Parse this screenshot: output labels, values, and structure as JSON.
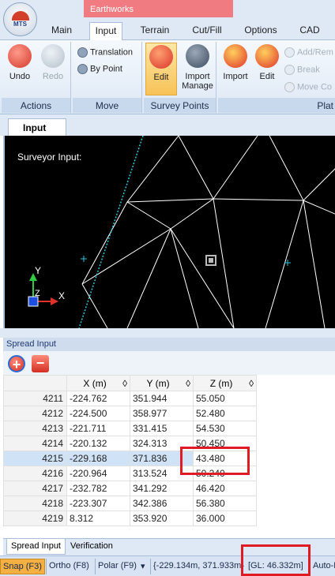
{
  "app": {
    "title": "Earthworks",
    "logo_text": "MTS"
  },
  "tabs": [
    {
      "label": "Main"
    },
    {
      "label": "Input"
    },
    {
      "label": "Terrain"
    },
    {
      "label": "Cut/Fill"
    },
    {
      "label": "Options"
    },
    {
      "label": "CAD"
    }
  ],
  "active_tab": "Input",
  "ribbon": {
    "actions": {
      "label": "Actions",
      "undo": "Undo",
      "redo": "Redo"
    },
    "move": {
      "label": "Move",
      "translation": "Translation",
      "by_point": "By Point"
    },
    "survey_points": {
      "label": "Survey Points",
      "edit": "Edit",
      "import_manage_line1": "Import",
      "import_manage_line2": "Manage"
    },
    "platform": {
      "label": "Plat",
      "import": "Import",
      "edit": "Edit",
      "add_remove": "Add/Rem",
      "break": "Break",
      "move_co": "Move Co"
    }
  },
  "document_tab": "Input",
  "canvas": {
    "label": "Surveyor Input:",
    "axis_y": "Y",
    "axis_x": "X",
    "axis_z": "Z"
  },
  "spread": {
    "title": "Spread Input",
    "add_icon": "plus-icon",
    "remove_icon": "minus-icon",
    "columns": [
      "X (m)",
      "Y (m)",
      "Z (m)"
    ],
    "sort_glyph": "◊",
    "rows": [
      {
        "id": "4211",
        "x": "-224.762",
        "y": "351.944",
        "z": "55.050"
      },
      {
        "id": "4212",
        "x": "-224.500",
        "y": "358.977",
        "z": "52.480"
      },
      {
        "id": "4213",
        "x": "-221.711",
        "y": "331.415",
        "z": "54.530"
      },
      {
        "id": "4214",
        "x": "-220.132",
        "y": "324.313",
        "z": "50.450"
      },
      {
        "id": "4215",
        "x": "-229.168",
        "y": "371.836",
        "z": "43.480"
      },
      {
        "id": "4216",
        "x": "-220.964",
        "y": "313.524",
        "z": "50.240"
      },
      {
        "id": "4217",
        "x": "-232.782",
        "y": "341.292",
        "z": "46.420"
      },
      {
        "id": "4218",
        "x": "-223.307",
        "y": "342.386",
        "z": "56.380"
      },
      {
        "id": "4219",
        "x": "8.312",
        "y": "353.920",
        "z": "36.000"
      }
    ],
    "selected_row": "4215"
  },
  "bottom_tabs": [
    "Spread Input",
    "Verification"
  ],
  "status": {
    "snap": "Snap (F3)",
    "ortho": "Ortho (F8)",
    "polar": "Polar (F9)",
    "coords": "{-229.134m, 371.933m}",
    "gl": "[GL: 46.332m]",
    "auto": "Auto-R"
  },
  "colors": {
    "accent": "#e01b24",
    "title_bg": "#f07c82",
    "selection": "#cfe2f6",
    "snap_bg": "#f5b041"
  }
}
